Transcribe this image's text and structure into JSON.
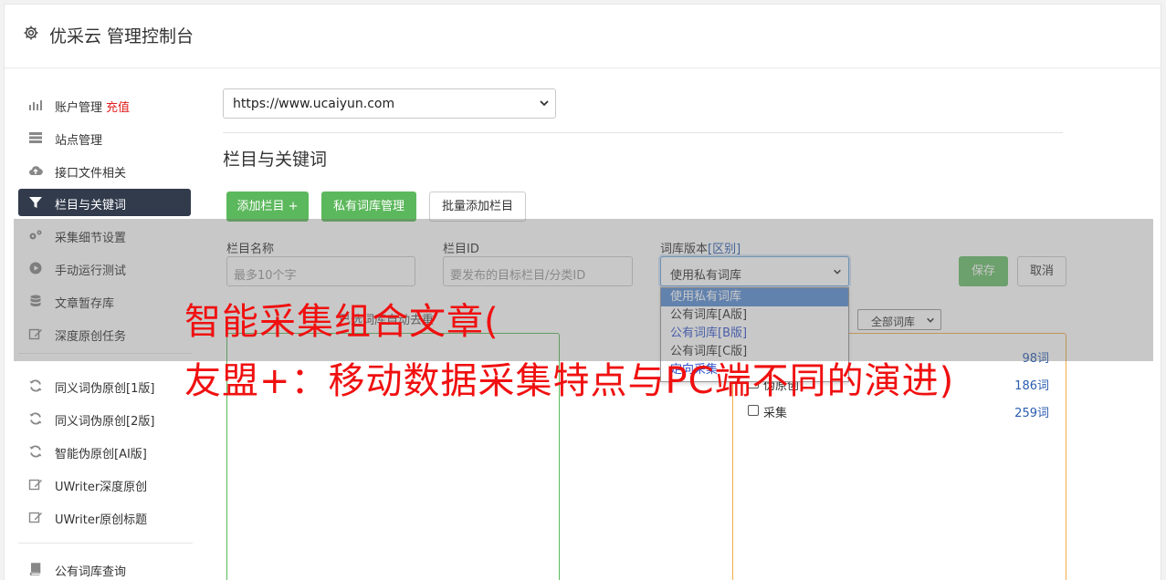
{
  "header": {
    "title": "优采云 管理控制台",
    "icon": "gear-icon"
  },
  "sidebar": {
    "items": [
      {
        "label": "账户管理",
        "extra": "充值",
        "icon": "bar-chart-icon"
      },
      {
        "label": "站点管理",
        "icon": "server-icon"
      },
      {
        "label": "接口文件相关",
        "icon": "cloud-upload-icon"
      },
      {
        "label": "栏目与关键词",
        "icon": "filter-icon",
        "active": true
      },
      {
        "label": "采集细节设置",
        "icon": "cogs-icon"
      },
      {
        "label": "手动运行测试",
        "icon": "play-circle-icon"
      },
      {
        "label": "文章暂存库",
        "icon": "database-icon"
      },
      {
        "label": "深度原创任务",
        "icon": "edit-icon"
      },
      {
        "label": "同义词伪原创[1版]",
        "icon": "refresh-icon"
      },
      {
        "label": "同义词伪原创[2版]",
        "icon": "refresh-icon"
      },
      {
        "label": "智能伪原创[AI版]",
        "icon": "refresh-icon"
      },
      {
        "label": "UWriter深度原创",
        "icon": "edit-icon"
      },
      {
        "label": "UWriter原创标题",
        "icon": "edit-icon"
      },
      {
        "label": "公有词库查询",
        "icon": "book-icon"
      }
    ]
  },
  "main": {
    "site_select": "https://www.ucaiyun.com",
    "section_title": "栏目与关键词",
    "buttons": {
      "add_column": "添加栏目 +",
      "private_lib": "私有词库管理",
      "batch_add": "批量添加栏目"
    },
    "form": {
      "name_label": "栏目名称",
      "name_placeholder": "最多10个字",
      "id_label": "栏目ID",
      "id_placeholder": "要发布的目标栏目/分类ID",
      "version_label": "词库版本",
      "version_link": "[区别]",
      "version_value": "使用私有词库",
      "save": "保存",
      "cancel": "取消"
    },
    "version_options": [
      "使用私有词库",
      "公有词库[A版]",
      "公有词库[B版]",
      "公有词库[C版]",
      "定向采集"
    ],
    "left_box_title": "已选词库自动去重",
    "lib_filter": "全部词库",
    "libraries": [
      {
        "name": "",
        "count": "98词"
      },
      {
        "name": "伪原创",
        "count": "186词"
      },
      {
        "name": "采集",
        "count": "259词"
      }
    ]
  },
  "watermark": {
    "line1": "智能采集组合文章(",
    "line2": "友盟+：移动数据采集特点与PC端不同的演进)"
  }
}
